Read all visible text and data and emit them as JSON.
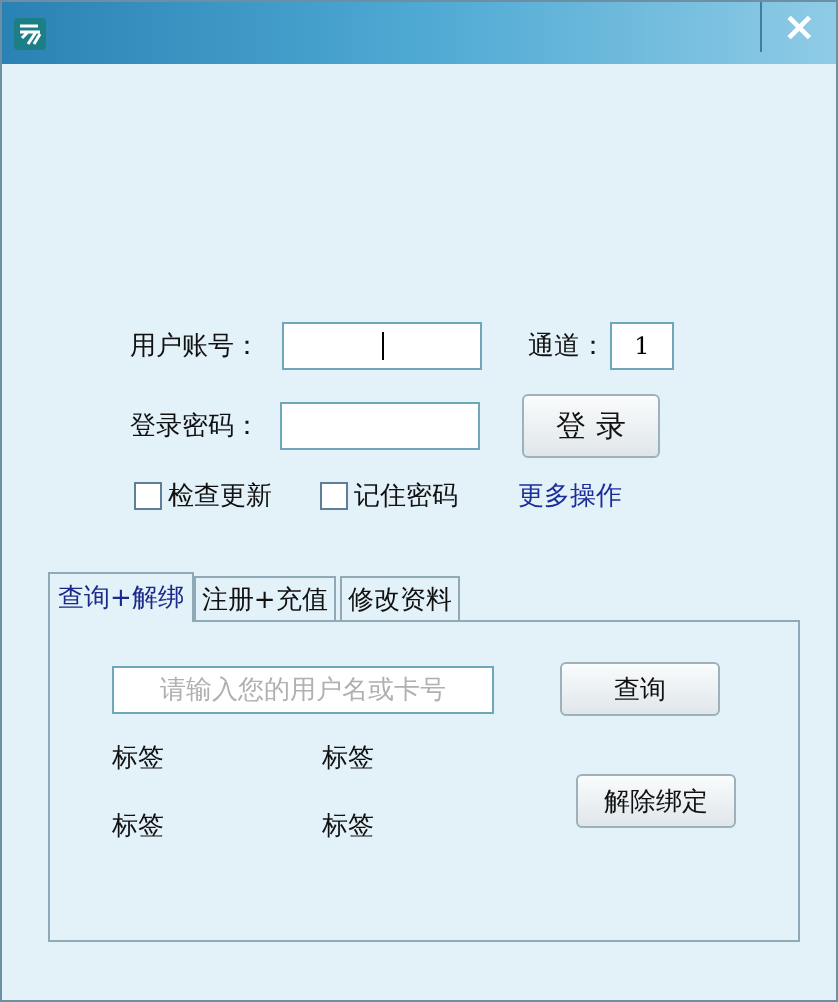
{
  "window": {
    "close": "×"
  },
  "login": {
    "account_label": "用户账号：",
    "account": {
      "focused": true
    },
    "channel_label": "通道：",
    "channel": "1",
    "password_label": "登录密码：",
    "password": {
      "focused": false
    },
    "login_button": "登 录",
    "checkboxes": [
      {
        "label": "检查更新",
        "checked": false
      },
      {
        "label": "记住密码",
        "checked": false
      }
    ],
    "more_link": "更多操作"
  },
  "tabs": [
    {
      "label": "查询+解绑",
      "selected": true
    },
    {
      "label": "注册+充值",
      "selected": false
    },
    {
      "label": "修改资料",
      "selected": false
    }
  ],
  "panel": {
    "search": {
      "placeholder": "请输入您的用户名或卡号"
    },
    "query_button": "查询",
    "labels": [
      "标签",
      "标签",
      "标签",
      "标签"
    ],
    "unbind_button": "解除绑定"
  }
}
